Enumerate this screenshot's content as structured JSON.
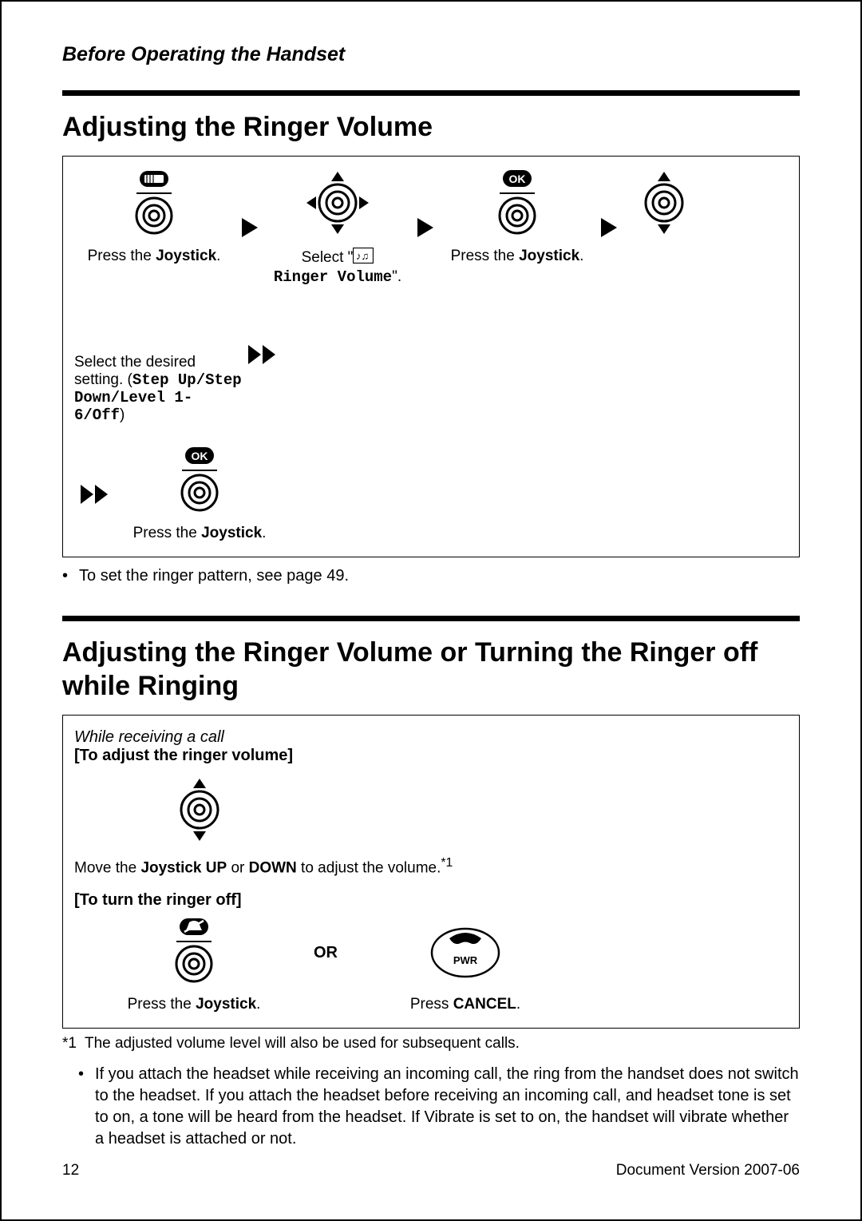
{
  "header": "Before Operating the Handset",
  "section1": {
    "title": "Adjusting the Ringer Volume",
    "steps": {
      "s1_pre": "Press the ",
      "s1_b": "Joystick",
      "s1_post": ".",
      "s2_pre": "Select \"",
      "s2_icon_label": "music-icon",
      "s2_mono": "Ringer Volume",
      "s2_post": "\".",
      "s3_pre": "Press the ",
      "s3_b": "Joystick",
      "s3_post": ".",
      "s4_pre": "Select the desired setting. (",
      "s4_mono": "Step Up/Step Down/Level 1-6/Off",
      "s4_post": ")",
      "s5_pre": "Press the ",
      "s5_b": "Joystick",
      "s5_post": "."
    },
    "bullet": "To set the ringer pattern, see page 49."
  },
  "section2": {
    "title": "Adjusting the Ringer Volume or Turning the Ringer off while Ringing",
    "intro_italic": "While receiving a call",
    "label_adjust": "[To adjust the ringer volume]",
    "move_pre": "Move the ",
    "move_b1": "Joystick UP",
    "move_mid": " or ",
    "move_b2": "DOWN",
    "move_post": " to adjust the volume.",
    "move_sup": "*1",
    "label_off": "[To turn the ringer off]",
    "or": "OR",
    "press_joy_pre": "Press the ",
    "press_joy_b": "Joystick",
    "press_joy_post": ".",
    "press_cancel_pre": "Press ",
    "press_cancel_b": "CANCEL",
    "press_cancel_post": ".",
    "footnote_marker": "*1",
    "footnote_text": "The adjusted volume level will also be used for subsequent calls.",
    "bullet": "If you attach the headset while receiving an incoming call, the ring from the handset does not switch to the headset. If you attach the headset before receiving an incoming call, and headset tone is set to on, a tone will be heard from the headset. If Vibrate is set to on, the handset will vibrate whether a headset is attached or not."
  },
  "footer": {
    "page": "12",
    "version": "Document Version 2007-06"
  }
}
